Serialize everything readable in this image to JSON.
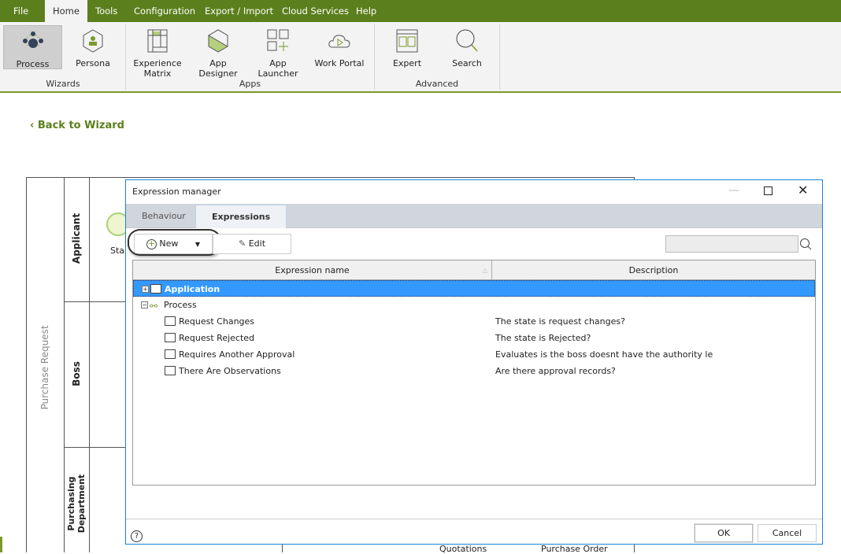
{
  "menu": [
    "File",
    "Home",
    "Tools",
    "Configuration",
    "Export / Import",
    "Cloud Services",
    "Help"
  ],
  "ribbon": {
    "wizards": {
      "label": "Wizards",
      "items": [
        "Process",
        "Persona"
      ]
    },
    "apps": {
      "label": "Apps",
      "items": [
        "Experience Matrix",
        "App Designer",
        "App Launcher",
        "Work Portal"
      ]
    },
    "advanced": {
      "label": "Advanced",
      "items": [
        "Expert",
        "Search"
      ]
    }
  },
  "back_label": "Back to Wizard",
  "diagram": {
    "pool": "Purchase Request",
    "lanes": [
      "Applicant",
      "Boss",
      "Purchasing Department"
    ],
    "start_label": "Star",
    "bottom_labels": [
      "Quotations",
      "Purchase Order"
    ]
  },
  "dialog": {
    "title": "Expression manager",
    "tabs": [
      "Behaviour",
      "Expressions"
    ],
    "new_label": "New",
    "edit_label": "Edit",
    "search_value": "",
    "columns": [
      "Expression name",
      "Description"
    ],
    "rows": [
      {
        "name": "Application",
        "desc": "",
        "level": 0,
        "expand": "+",
        "selected": true
      },
      {
        "name": "Process",
        "desc": "",
        "level": 0,
        "expand": "-"
      },
      {
        "name": "Request Changes",
        "desc": "The state is request changes?",
        "level": 1
      },
      {
        "name": "Request Rejected",
        "desc": "The state is Rejected?",
        "level": 1
      },
      {
        "name": "Requires Another Approval",
        "desc": "Evaluates is the boss doesnt have the authority le",
        "level": 1
      },
      {
        "name": "There Are Observations",
        "desc": "Are there approval records?",
        "level": 1
      }
    ],
    "ok_label": "OK",
    "cancel_label": "Cancel",
    "help_icon": "?"
  },
  "colors": {
    "brand": "#5c7f1d",
    "selection": "#3399ff",
    "dialog_border": "#1883d7"
  }
}
